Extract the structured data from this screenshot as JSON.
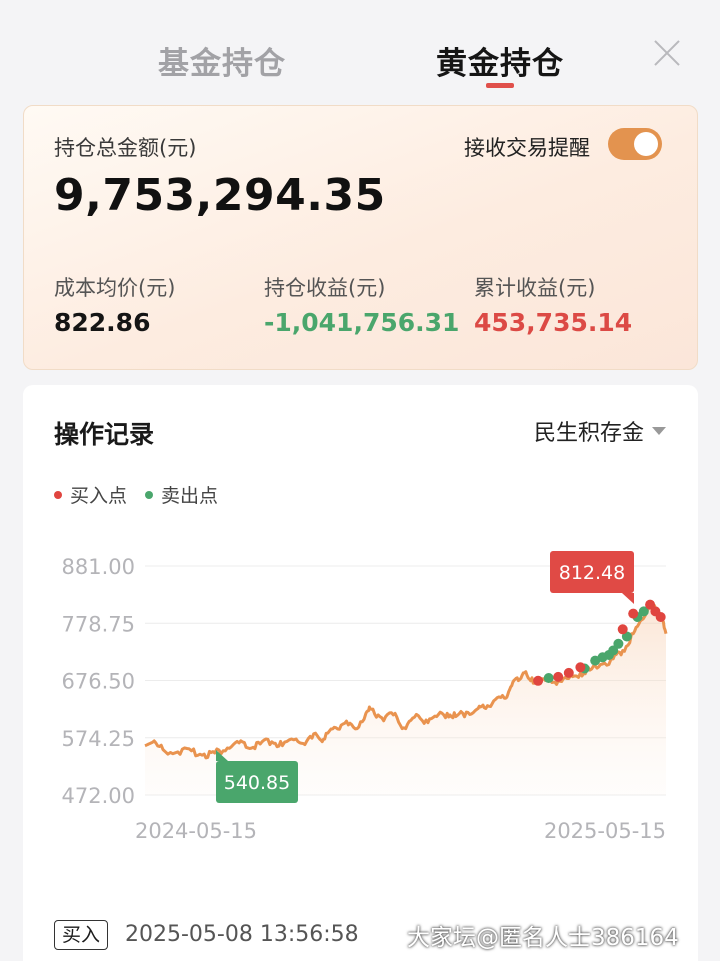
{
  "tabs": {
    "fund": "基金持仓",
    "gold": "黄金持仓"
  },
  "summary": {
    "total_label": "持仓总金额(元)",
    "total_value": "9,753,294.35",
    "alert_label": "接收交易提醒",
    "alert_on": true,
    "avg_cost_label": "成本均价(元)",
    "avg_cost_value": "822.86",
    "position_profit_label": "持仓收益(元)",
    "position_profit_value": "-1,041,756.31",
    "cumulative_profit_label": "累计收益(元)",
    "cumulative_profit_value": "453,735.14"
  },
  "records": {
    "title": "操作记录",
    "bank_selector": "民生积存金",
    "legend": {
      "buy": "买入点",
      "sell": "卖出点"
    }
  },
  "chart_data": {
    "type": "line",
    "ylim": [
      472.0,
      881.0
    ],
    "yticks": [
      "881.00",
      "778.75",
      "676.50",
      "574.25",
      "472.00"
    ],
    "xtick_labels": [
      "2024-05-15",
      "2025-05-15"
    ],
    "high_label": "812.48",
    "low_label": "540.85",
    "series_color": "#e9934f",
    "price_path": [
      [
        "2024-05-15",
        560
      ],
      [
        "2024-05-22",
        566
      ],
      [
        "2024-06-01",
        553
      ],
      [
        "2024-06-15",
        549
      ],
      [
        "2024-06-28",
        551
      ],
      [
        "2024-07-10",
        545
      ],
      [
        "2024-07-20",
        547
      ],
      [
        "2024-08-01",
        556
      ],
      [
        "2024-08-12",
        565
      ],
      [
        "2024-08-22",
        555
      ],
      [
        "2024-09-01",
        563
      ],
      [
        "2024-09-12",
        567
      ],
      [
        "2024-09-22",
        560
      ],
      [
        "2024-10-05",
        572
      ],
      [
        "2024-10-15",
        568
      ],
      [
        "2024-10-25",
        578
      ],
      [
        "2024-11-01",
        572
      ],
      [
        "2024-11-10",
        593
      ],
      [
        "2024-11-20",
        600
      ],
      [
        "2024-11-30",
        590
      ],
      [
        "2024-12-10",
        618
      ],
      [
        "2024-12-15",
        625
      ],
      [
        "2024-12-25",
        610
      ],
      [
        "2025-01-05",
        615
      ],
      [
        "2025-01-15",
        592
      ],
      [
        "2025-01-25",
        611
      ],
      [
        "2025-02-05",
        606
      ],
      [
        "2025-02-15",
        612
      ],
      [
        "2025-02-25",
        618
      ],
      [
        "2025-03-05",
        612
      ],
      [
        "2025-03-15",
        620
      ],
      [
        "2025-03-25",
        625
      ],
      [
        "2025-04-01",
        628
      ],
      [
        "2025-04-10",
        640
      ],
      [
        "2025-04-20",
        645
      ],
      [
        "2025-04-25",
        660
      ],
      [
        "2025-05-01",
        680
      ],
      [
        "2025-05-08",
        690
      ],
      [
        "2025-05-15",
        676
      ],
      [
        "2025-05-22",
        676
      ],
      [
        "2025-06-01",
        675
      ],
      [
        "2025-06-10",
        676
      ],
      [
        "2025-06-20",
        680
      ],
      [
        "2025-07-01",
        690
      ],
      [
        "2025-07-10",
        695
      ],
      [
        "2025-07-20",
        705
      ],
      [
        "2025-08-01",
        715
      ],
      [
        "2025-08-10",
        730
      ],
      [
        "2025-08-20",
        760
      ],
      [
        "2025-08-28",
        785
      ],
      [
        "2025-09-05",
        812
      ],
      [
        "2025-09-10",
        805
      ],
      [
        "2025-09-15",
        790
      ],
      [
        "2025-09-20",
        760
      ]
    ],
    "buy_points": [
      [
        "2025-05-22",
        676
      ],
      [
        "2025-06-10",
        683
      ],
      [
        "2025-06-20",
        690
      ],
      [
        "2025-07-01",
        700
      ],
      [
        "2025-08-10",
        768
      ],
      [
        "2025-08-20",
        796
      ],
      [
        "2025-09-05",
        812
      ],
      [
        "2025-09-10",
        800
      ],
      [
        "2025-09-15",
        790
      ]
    ],
    "sell_points": [
      [
        "2025-06-01",
        681
      ],
      [
        "2025-07-05",
        698
      ],
      [
        "2025-07-15",
        712
      ],
      [
        "2025-07-22",
        718
      ],
      [
        "2025-07-28",
        722
      ],
      [
        "2025-08-01",
        730
      ],
      [
        "2025-08-06",
        742
      ],
      [
        "2025-08-14",
        755
      ],
      [
        "2025-08-24",
        790
      ],
      [
        "2025-08-30",
        800
      ]
    ]
  },
  "record_row": {
    "action": "买入",
    "time": "2025-05-08 13:56:58"
  },
  "watermark": "大家坛@匿名人士386164"
}
